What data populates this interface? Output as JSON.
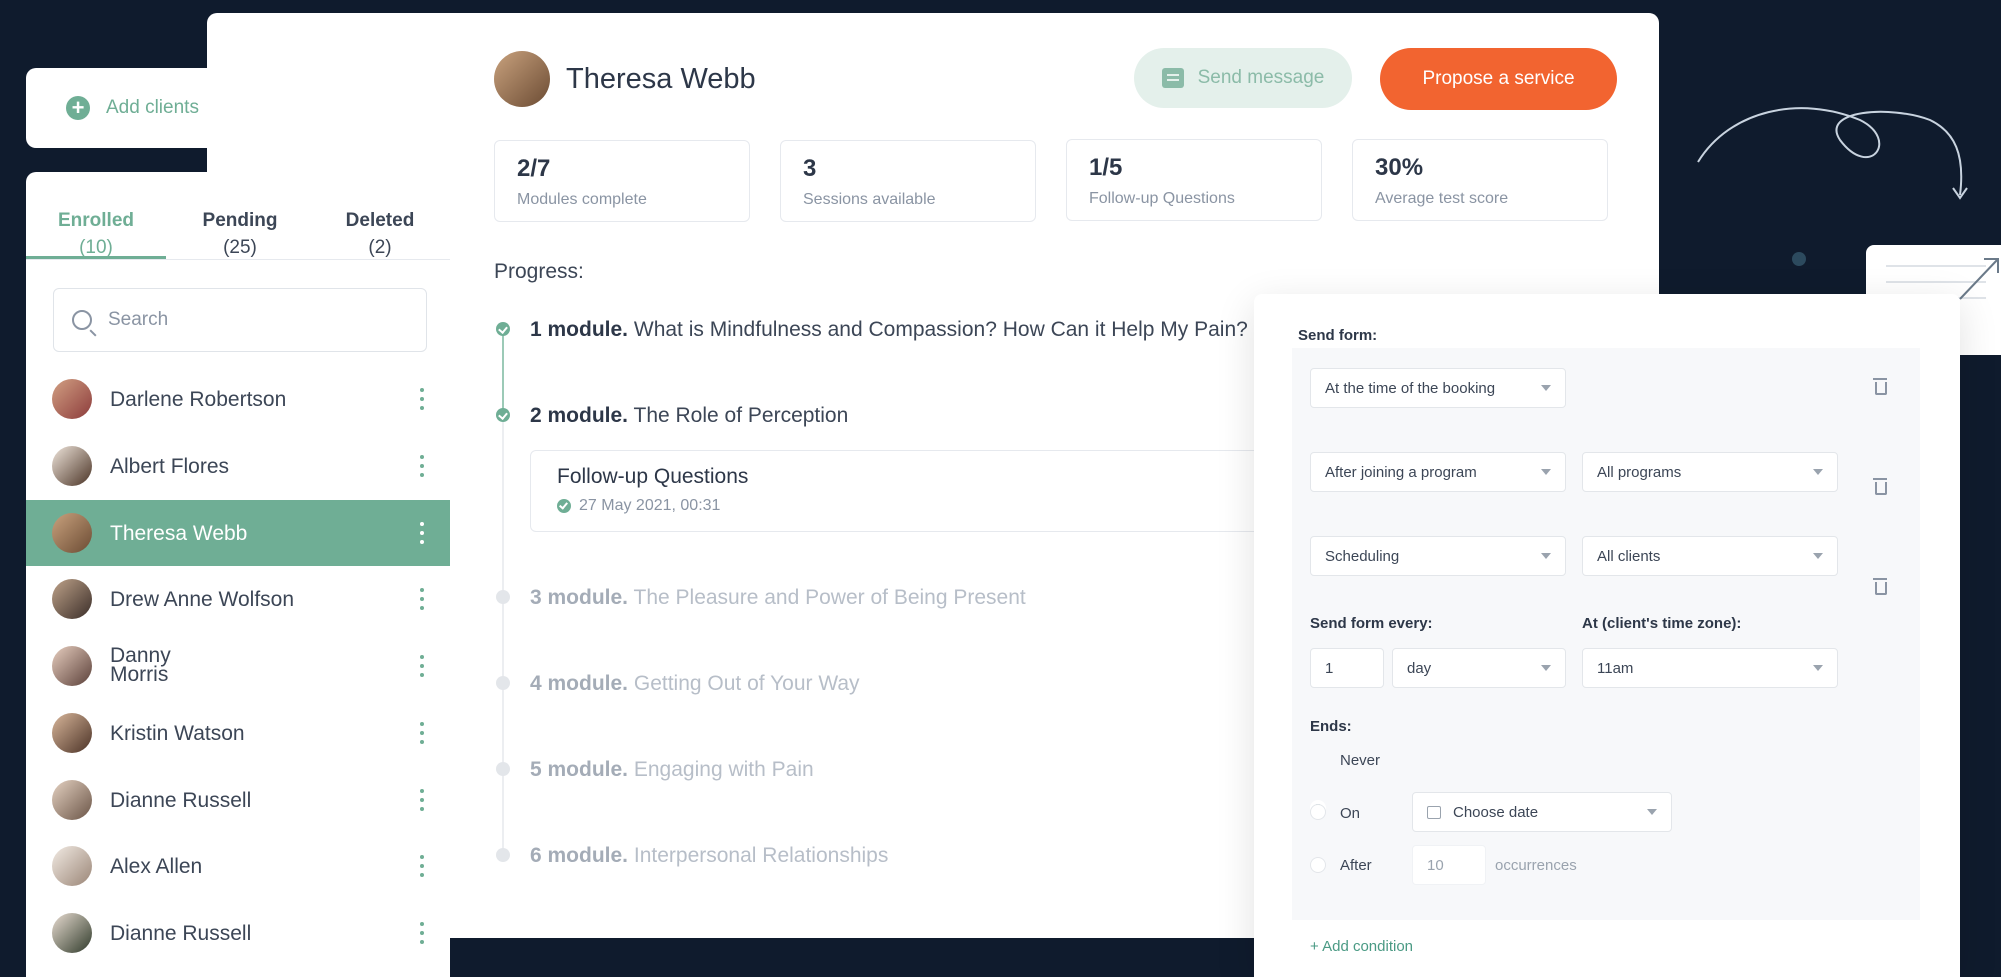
{
  "add_clients": {
    "label": "Add clients"
  },
  "client": {
    "name": "Theresa Webb"
  },
  "actions": {
    "send_message": "Send message",
    "propose_service": "Propose a service"
  },
  "stats": [
    {
      "value": "2/7",
      "label": "Modules complete"
    },
    {
      "value": "3",
      "label": "Sessions available"
    },
    {
      "value": "1/5",
      "label": "Follow-up Questions"
    },
    {
      "value": "30%",
      "label": "Average test score"
    }
  ],
  "progress": {
    "label": "Progress:",
    "modules": [
      {
        "num": "1 module.",
        "title": "What is Mindfulness and Compassion? How Can it Help My Pain?",
        "done": true
      },
      {
        "num": "2 module.",
        "title": "The Role of Perception",
        "done": true
      },
      {
        "num": "3 module.",
        "title": "The Pleasure and Power of Being Present",
        "done": false
      },
      {
        "num": "4 module.",
        "title": "Getting Out of Your Way",
        "done": false
      },
      {
        "num": "5 module.",
        "title": "Engaging with Pain",
        "done": false
      },
      {
        "num": "6 module.",
        "title": "Interpersonal Relationships",
        "done": false
      }
    ],
    "followup": {
      "title": "Follow-up Questions",
      "date": "27 May 2021, 00:31"
    }
  },
  "tabs": [
    {
      "label": "Enrolled",
      "count": "(10)"
    },
    {
      "label": "Pending",
      "count": "(25)"
    },
    {
      "label": "Deleted",
      "count": "(2)"
    }
  ],
  "search": {
    "placeholder": "Search"
  },
  "clients": [
    {
      "name": "Darlene Robertson"
    },
    {
      "name": "Albert Flores"
    },
    {
      "name": "Theresa Webb"
    },
    {
      "name": "Drew Anne Wolfson"
    },
    {
      "name": "Danny\nMorris"
    },
    {
      "name": "Kristin Watson"
    },
    {
      "name": "Dianne Russell"
    },
    {
      "name": "Alex Allen"
    },
    {
      "name": "Dianne Russell"
    }
  ],
  "form": {
    "send_form_label": "Send form:",
    "rows": [
      {
        "first": "At the time of the booking",
        "second": ""
      },
      {
        "first": "After joining a program",
        "second": "All programs"
      },
      {
        "first": "Scheduling",
        "second": "All clients"
      }
    ],
    "every_label": "Send form every:",
    "tz_label": "At (client's time zone):",
    "every_value": "1",
    "every_unit": "day",
    "time_value": "11am",
    "ends_label": "Ends:",
    "never": "Never",
    "on": "On",
    "choose_date": "Choose date",
    "after": "After",
    "occurrences_value": "10",
    "occurrences": "occurrences",
    "add_condition": "Add condition"
  },
  "colors": {
    "accent": "#6fae95",
    "orange": "#f26430",
    "background": "#0f1b2d"
  }
}
